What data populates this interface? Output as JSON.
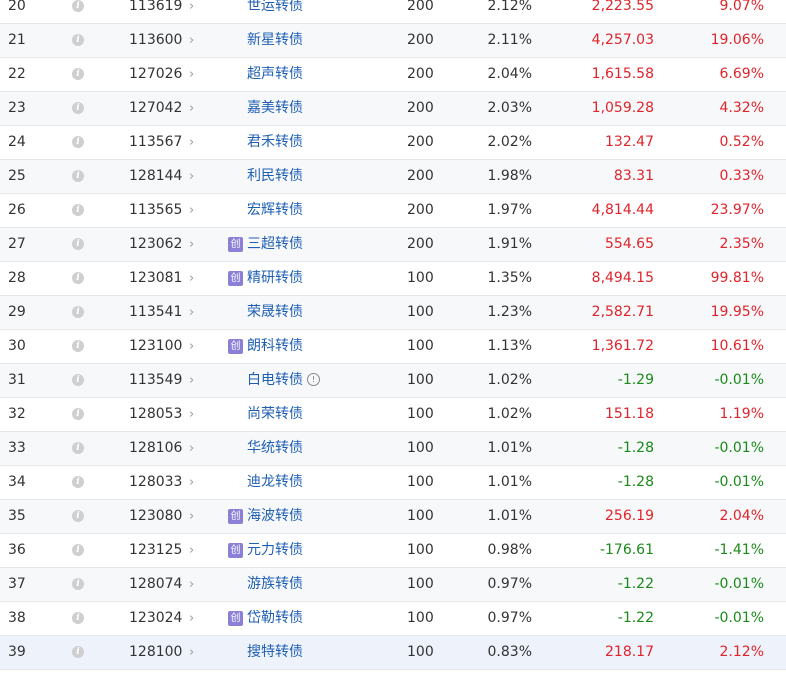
{
  "holdings": {
    "rows": [
      {
        "index": "20",
        "code": "113619",
        "name": "世运转债",
        "badge": "",
        "warn": false,
        "qty": "200",
        "pct": "2.12%",
        "value": "2,223.55",
        "change": "9.07%",
        "trend": "up"
      },
      {
        "index": "21",
        "code": "113600",
        "name": "新星转债",
        "badge": "",
        "warn": false,
        "qty": "200",
        "pct": "2.11%",
        "value": "4,257.03",
        "change": "19.06%",
        "trend": "up"
      },
      {
        "index": "22",
        "code": "127026",
        "name": "超声转债",
        "badge": "",
        "warn": false,
        "qty": "200",
        "pct": "2.04%",
        "value": "1,615.58",
        "change": "6.69%",
        "trend": "up"
      },
      {
        "index": "23",
        "code": "127042",
        "name": "嘉美转债",
        "badge": "",
        "warn": false,
        "qty": "200",
        "pct": "2.03%",
        "value": "1,059.28",
        "change": "4.32%",
        "trend": "up"
      },
      {
        "index": "24",
        "code": "113567",
        "name": "君禾转债",
        "badge": "",
        "warn": false,
        "qty": "200",
        "pct": "2.02%",
        "value": "132.47",
        "change": "0.52%",
        "trend": "up"
      },
      {
        "index": "25",
        "code": "128144",
        "name": "利民转债",
        "badge": "",
        "warn": false,
        "qty": "200",
        "pct": "1.98%",
        "value": "83.31",
        "change": "0.33%",
        "trend": "up"
      },
      {
        "index": "26",
        "code": "113565",
        "name": "宏辉转债",
        "badge": "",
        "warn": false,
        "qty": "200",
        "pct": "1.97%",
        "value": "4,814.44",
        "change": "23.97%",
        "trend": "up"
      },
      {
        "index": "27",
        "code": "123062",
        "name": "三超转债",
        "badge": "创",
        "warn": false,
        "qty": "200",
        "pct": "1.91%",
        "value": "554.65",
        "change": "2.35%",
        "trend": "up"
      },
      {
        "index": "28",
        "code": "123081",
        "name": "精研转债",
        "badge": "创",
        "warn": false,
        "qty": "100",
        "pct": "1.35%",
        "value": "8,494.15",
        "change": "99.81%",
        "trend": "up"
      },
      {
        "index": "29",
        "code": "113541",
        "name": "荣晟转债",
        "badge": "",
        "warn": false,
        "qty": "100",
        "pct": "1.23%",
        "value": "2,582.71",
        "change": "19.95%",
        "trend": "up"
      },
      {
        "index": "30",
        "code": "123100",
        "name": "朗科转债",
        "badge": "创",
        "warn": false,
        "qty": "100",
        "pct": "1.13%",
        "value": "1,361.72",
        "change": "10.61%",
        "trend": "up"
      },
      {
        "index": "31",
        "code": "113549",
        "name": "白电转债",
        "badge": "",
        "warn": true,
        "qty": "100",
        "pct": "1.02%",
        "value": "-1.29",
        "change": "-0.01%",
        "trend": "down"
      },
      {
        "index": "32",
        "code": "128053",
        "name": "尚荣转债",
        "badge": "",
        "warn": false,
        "qty": "100",
        "pct": "1.02%",
        "value": "151.18",
        "change": "1.19%",
        "trend": "up"
      },
      {
        "index": "33",
        "code": "128106",
        "name": "华统转债",
        "badge": "",
        "warn": false,
        "qty": "100",
        "pct": "1.01%",
        "value": "-1.28",
        "change": "-0.01%",
        "trend": "down"
      },
      {
        "index": "34",
        "code": "128033",
        "name": "迪龙转债",
        "badge": "",
        "warn": false,
        "qty": "100",
        "pct": "1.01%",
        "value": "-1.28",
        "change": "-0.01%",
        "trend": "down"
      },
      {
        "index": "35",
        "code": "123080",
        "name": "海波转债",
        "badge": "创",
        "warn": false,
        "qty": "100",
        "pct": "1.01%",
        "value": "256.19",
        "change": "2.04%",
        "trend": "up"
      },
      {
        "index": "36",
        "code": "123125",
        "name": "元力转债",
        "badge": "创",
        "warn": false,
        "qty": "100",
        "pct": "0.98%",
        "value": "-176.61",
        "change": "-1.41%",
        "trend": "down"
      },
      {
        "index": "37",
        "code": "128074",
        "name": "游族转债",
        "badge": "",
        "warn": false,
        "qty": "100",
        "pct": "0.97%",
        "value": "-1.22",
        "change": "-0.01%",
        "trend": "down"
      },
      {
        "index": "38",
        "code": "123024",
        "name": "岱勒转债",
        "badge": "创",
        "warn": false,
        "qty": "100",
        "pct": "0.97%",
        "value": "-1.22",
        "change": "-0.01%",
        "trend": "down"
      },
      {
        "index": "39",
        "code": "128100",
        "name": "搜特转债",
        "badge": "",
        "warn": false,
        "qty": "100",
        "pct": "0.83%",
        "value": "218.17",
        "change": "2.12%",
        "trend": "up"
      }
    ],
    "info_icon": "info-icon",
    "info_glyph": "i",
    "chevron_icon": "chevron-right-icon",
    "chevron_glyph": "›",
    "warn_icon": "warning-circle-icon",
    "warn_glyph": "!",
    "colors": {
      "up": "#e0242b",
      "down": "#1a8a1a",
      "link": "#1f5fb4",
      "badge": "#8b7fd6"
    }
  }
}
